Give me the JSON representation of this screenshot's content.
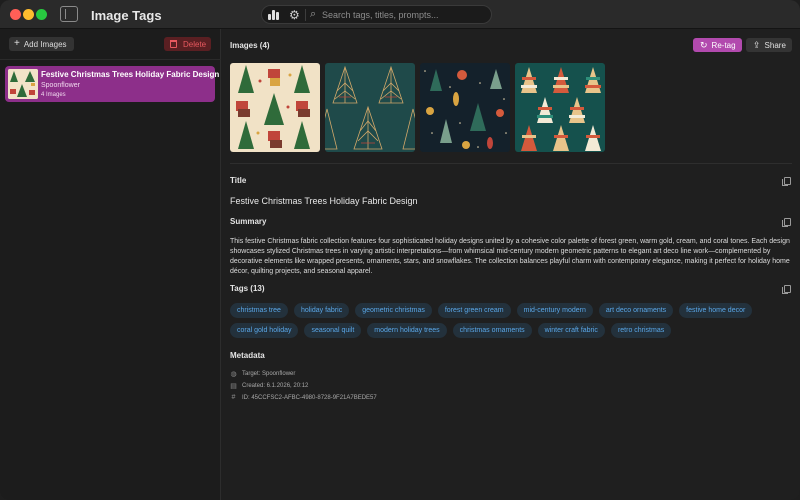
{
  "app": {
    "title": "Image Tags"
  },
  "toolbar": {
    "search_placeholder": "Search tags, titles, prompts..."
  },
  "sidebar": {
    "add_label": "Add Images",
    "delete_label": "Delete",
    "items": [
      {
        "title": "Festive Christmas Trees Holiday Fabric Design",
        "source": "Spoonflower",
        "count": "4 Images"
      }
    ]
  },
  "main": {
    "images_header": "Images (4)",
    "retag_label": "Re-tag",
    "share_label": "Share",
    "title_header": "Title",
    "title_value": "Festive Christmas Trees Holiday Fabric Design",
    "summary_header": "Summary",
    "summary_text": "This festive Christmas fabric collection features four sophisticated holiday designs united by a cohesive color palette of forest green, warm gold, cream, and coral tones. Each design showcases stylized Christmas trees in varying artistic interpretations—from whimsical mid-century modern geometric patterns to elegant art deco line work—complemented by decorative elements like wrapped presents, ornaments, stars, and snowflakes. The collection balances playful charm with contemporary elegance, making it perfect for holiday home décor, quilting projects, and seasonal apparel.",
    "tags_header": "Tags (13)",
    "tags": [
      "christmas tree",
      "holiday fabric",
      "geometric christmas",
      "forest green cream",
      "mid-century modern",
      "art deco ornaments",
      "festive home decor",
      "coral gold holiday",
      "seasonal quilt",
      "modern holiday trees",
      "christmas ornaments",
      "winter craft fabric",
      "retro christmas"
    ],
    "metadata_header": "Metadata",
    "metadata": {
      "target": "Target: Spoonflower",
      "created": "Created: 6.1.2026, 20:12",
      "id": "ID: 45CCFSC2-AFBC-4980-8728-9F21A7BEDE57"
    }
  },
  "colors": {
    "accent": "#b24aae",
    "selection": "#8d2f8a",
    "danger": "#e8595f",
    "tag_text": "#5aa7e8"
  }
}
